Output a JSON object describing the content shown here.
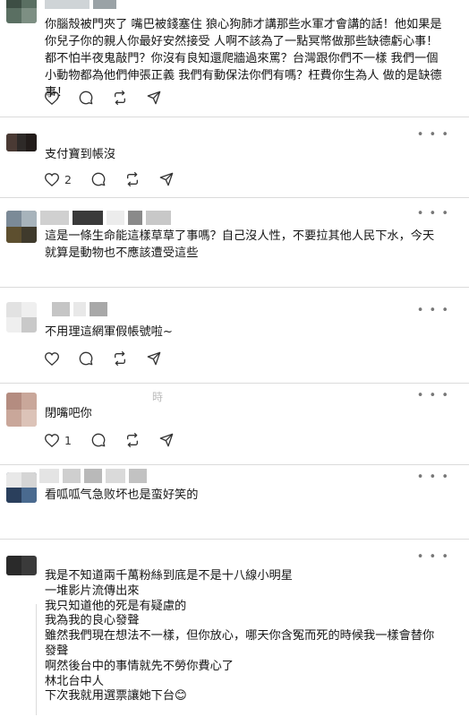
{
  "posts": [
    {
      "text": "你腦殼被門夾了 嘴巴被錢塞住 狼心狗肺才講那些水軍才會講的話！他如果是你兒子你的親人你最好安然接受 人啊不該為了一點冥幣做那些缺德虧心事！都不怕半夜鬼敲門？你沒有良知還爬牆過來罵？台灣跟你們不一樣 我們一個小動物都為他們伸張正義 我們有動保法你們有嗎？枉費你生為人 做的是缺德事！",
      "likes": ""
    },
    {
      "text": "支付寶到帳沒",
      "likes": "2"
    },
    {
      "text": "這是一條生命能這樣草草了事嗎？自己沒人性，不要拉其他人民下水，今天就算是動物也不應該遭受這些",
      "likes": ""
    },
    {
      "text": "不用理這網軍假帳號啦~",
      "likes": ""
    },
    {
      "text": "閉嘴吧你",
      "likes": "1"
    },
    {
      "text": "看呱呱气急败坏也是蛮好笑的",
      "likes": ""
    },
    {
      "text": "我是不知道兩千萬粉絲到底是不是十八線小明星\n一堆影片流傳出來\n我只知道他的死是有疑慮的\n我為我的良心發聲\n雖然我們現在想法不一樣，但你放心，哪天你含冤而死的時候我一樣會替你發聲\n啊然後台中的事情就先不勞你費心了\n林北台中人\n下次我就用選票讓她下台😊",
      "likes": ""
    }
  ],
  "more_label": "• • •",
  "snippet_label": "時",
  "icons": [
    "heart-icon",
    "comment-icon",
    "repost-icon",
    "share-icon",
    "more-icon"
  ]
}
